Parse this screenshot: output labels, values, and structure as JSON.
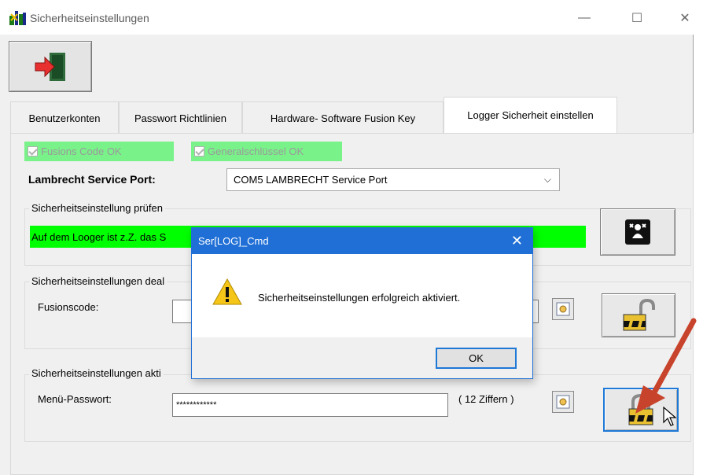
{
  "window": {
    "title": "Sicherheitseinstellungen",
    "minimize_glyph": "—",
    "maximize_glyph": "☐",
    "close_glyph": "✕"
  },
  "toolbar": {
    "exit_icon": "exit-door-icon"
  },
  "tabs": [
    {
      "label": "Benutzerkonten",
      "active": false
    },
    {
      "label": "Passwort Richtlinien",
      "active": false
    },
    {
      "label": "Hardware- Software Fusion Key",
      "active": false
    },
    {
      "label": "Logger Sicherheit einstellen",
      "active": true
    }
  ],
  "checks": {
    "fusion_code": "Fusions Code  OK",
    "general_key": "Generalschlüssel OK"
  },
  "port": {
    "label": "Lambrecht Service  Port:",
    "value": "COM5  LAMBRECHT Service Port"
  },
  "check_group": {
    "title": "Sicherheitseinstellung prüfen",
    "status_text": "Auf dem Looger ist z.Z. das S"
  },
  "deactivate_group": {
    "title": "Sicherheitseinstellungen deal",
    "fusion_label": "Fusionscode:"
  },
  "activate_group": {
    "title": "Sicherheitseinstellungen akti",
    "menu_pw_label": "Menü-Passwort:",
    "password_value": "************",
    "hint": "( 12 Ziffern )"
  },
  "dialog": {
    "title": "Ser[LOG]_Cmd",
    "close_glyph": "✕",
    "message": "Sicherheitseinstellungen erfolgreich aktiviert.",
    "ok_label": "OK"
  },
  "colors": {
    "status_green": "#00ff00",
    "check_green": "#7af28a",
    "dialog_blue": "#1f6fd6",
    "arrow_red": "#c8432b"
  }
}
